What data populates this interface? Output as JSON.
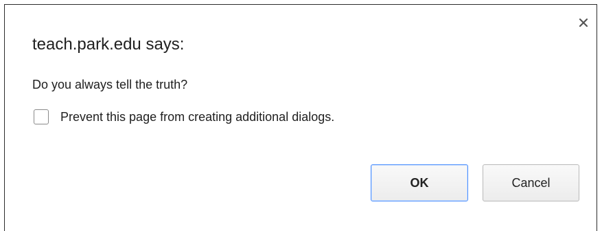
{
  "dialog": {
    "title": "teach.park.edu says:",
    "message": "Do you always tell the truth?",
    "checkbox_label": "Prevent this page from creating additional dialogs.",
    "checkbox_checked": false,
    "ok_label": "OK",
    "cancel_label": "Cancel",
    "close_icon": "close-icon"
  },
  "colors": {
    "ok_border": "#4d90fe",
    "text": "#202020"
  }
}
